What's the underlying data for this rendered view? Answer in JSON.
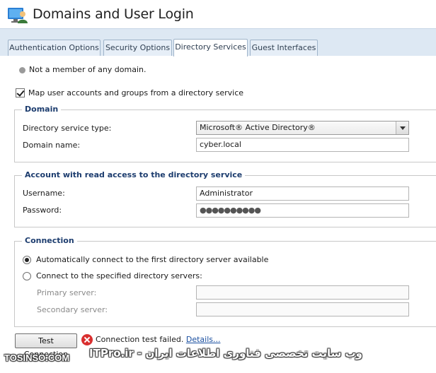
{
  "window": {
    "title": "Domains and User Login",
    "icon": "domain-users-icon"
  },
  "tabs": [
    {
      "label": "Authentication Options",
      "active": false
    },
    {
      "label": "Security Options",
      "active": false
    },
    {
      "label": "Directory Services",
      "active": true
    },
    {
      "label": "Guest Interfaces",
      "active": false
    }
  ],
  "status": {
    "text": "Not a member of any domain.",
    "icon": "status-dot-icon",
    "color": "#9a9a9a"
  },
  "map_accounts": {
    "label": "Map user accounts and groups from a directory service",
    "checked": true
  },
  "domain": {
    "title": "Domain",
    "type_label": "Directory service type:",
    "type_value": "Microsoft® Active Directory®",
    "name_label": "Domain name:",
    "name_value": "cyber.local"
  },
  "account": {
    "title": "Account with read access to the directory service",
    "username_label": "Username:",
    "username_value": "Administrator",
    "password_label": "Password:",
    "password_value": "●●●●●●●●●●"
  },
  "connection": {
    "title": "Connection",
    "auto_label": "Automatically connect to the first directory server available",
    "auto_selected": true,
    "specified_label": "Connect to the specified directory servers:",
    "specified_selected": false,
    "primary_label": "Primary server:",
    "primary_value": "",
    "secondary_label": "Secondary server:",
    "secondary_value": ""
  },
  "test": {
    "button_label": "Test Connection",
    "result_text": "Connection test failed.",
    "details_link": "Details...",
    "error_icon": "error-x-icon",
    "error_color": "#d92f2f"
  },
  "watermark": {
    "left": "TOSINSO.COM",
    "right": "وب سایت تخصصی فناوری اطلاعات ایران - ITPro.ir"
  }
}
